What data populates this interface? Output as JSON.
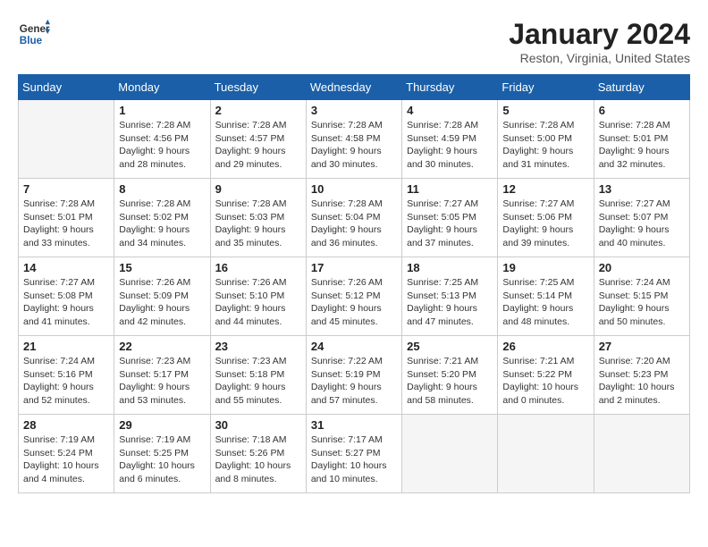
{
  "header": {
    "logo_line1": "General",
    "logo_line2": "Blue",
    "month": "January 2024",
    "location": "Reston, Virginia, United States"
  },
  "days_of_week": [
    "Sunday",
    "Monday",
    "Tuesday",
    "Wednesday",
    "Thursday",
    "Friday",
    "Saturday"
  ],
  "weeks": [
    [
      {
        "day": null,
        "info": null
      },
      {
        "day": "1",
        "info": "Sunrise: 7:28 AM\nSunset: 4:56 PM\nDaylight: 9 hours\nand 28 minutes."
      },
      {
        "day": "2",
        "info": "Sunrise: 7:28 AM\nSunset: 4:57 PM\nDaylight: 9 hours\nand 29 minutes."
      },
      {
        "day": "3",
        "info": "Sunrise: 7:28 AM\nSunset: 4:58 PM\nDaylight: 9 hours\nand 30 minutes."
      },
      {
        "day": "4",
        "info": "Sunrise: 7:28 AM\nSunset: 4:59 PM\nDaylight: 9 hours\nand 30 minutes."
      },
      {
        "day": "5",
        "info": "Sunrise: 7:28 AM\nSunset: 5:00 PM\nDaylight: 9 hours\nand 31 minutes."
      },
      {
        "day": "6",
        "info": "Sunrise: 7:28 AM\nSunset: 5:01 PM\nDaylight: 9 hours\nand 32 minutes."
      }
    ],
    [
      {
        "day": "7",
        "info": "Sunrise: 7:28 AM\nSunset: 5:01 PM\nDaylight: 9 hours\nand 33 minutes."
      },
      {
        "day": "8",
        "info": "Sunrise: 7:28 AM\nSunset: 5:02 PM\nDaylight: 9 hours\nand 34 minutes."
      },
      {
        "day": "9",
        "info": "Sunrise: 7:28 AM\nSunset: 5:03 PM\nDaylight: 9 hours\nand 35 minutes."
      },
      {
        "day": "10",
        "info": "Sunrise: 7:28 AM\nSunset: 5:04 PM\nDaylight: 9 hours\nand 36 minutes."
      },
      {
        "day": "11",
        "info": "Sunrise: 7:27 AM\nSunset: 5:05 PM\nDaylight: 9 hours\nand 37 minutes."
      },
      {
        "day": "12",
        "info": "Sunrise: 7:27 AM\nSunset: 5:06 PM\nDaylight: 9 hours\nand 39 minutes."
      },
      {
        "day": "13",
        "info": "Sunrise: 7:27 AM\nSunset: 5:07 PM\nDaylight: 9 hours\nand 40 minutes."
      }
    ],
    [
      {
        "day": "14",
        "info": "Sunrise: 7:27 AM\nSunset: 5:08 PM\nDaylight: 9 hours\nand 41 minutes."
      },
      {
        "day": "15",
        "info": "Sunrise: 7:26 AM\nSunset: 5:09 PM\nDaylight: 9 hours\nand 42 minutes."
      },
      {
        "day": "16",
        "info": "Sunrise: 7:26 AM\nSunset: 5:10 PM\nDaylight: 9 hours\nand 44 minutes."
      },
      {
        "day": "17",
        "info": "Sunrise: 7:26 AM\nSunset: 5:12 PM\nDaylight: 9 hours\nand 45 minutes."
      },
      {
        "day": "18",
        "info": "Sunrise: 7:25 AM\nSunset: 5:13 PM\nDaylight: 9 hours\nand 47 minutes."
      },
      {
        "day": "19",
        "info": "Sunrise: 7:25 AM\nSunset: 5:14 PM\nDaylight: 9 hours\nand 48 minutes."
      },
      {
        "day": "20",
        "info": "Sunrise: 7:24 AM\nSunset: 5:15 PM\nDaylight: 9 hours\nand 50 minutes."
      }
    ],
    [
      {
        "day": "21",
        "info": "Sunrise: 7:24 AM\nSunset: 5:16 PM\nDaylight: 9 hours\nand 52 minutes."
      },
      {
        "day": "22",
        "info": "Sunrise: 7:23 AM\nSunset: 5:17 PM\nDaylight: 9 hours\nand 53 minutes."
      },
      {
        "day": "23",
        "info": "Sunrise: 7:23 AM\nSunset: 5:18 PM\nDaylight: 9 hours\nand 55 minutes."
      },
      {
        "day": "24",
        "info": "Sunrise: 7:22 AM\nSunset: 5:19 PM\nDaylight: 9 hours\nand 57 minutes."
      },
      {
        "day": "25",
        "info": "Sunrise: 7:21 AM\nSunset: 5:20 PM\nDaylight: 9 hours\nand 58 minutes."
      },
      {
        "day": "26",
        "info": "Sunrise: 7:21 AM\nSunset: 5:22 PM\nDaylight: 10 hours\nand 0 minutes."
      },
      {
        "day": "27",
        "info": "Sunrise: 7:20 AM\nSunset: 5:23 PM\nDaylight: 10 hours\nand 2 minutes."
      }
    ],
    [
      {
        "day": "28",
        "info": "Sunrise: 7:19 AM\nSunset: 5:24 PM\nDaylight: 10 hours\nand 4 minutes."
      },
      {
        "day": "29",
        "info": "Sunrise: 7:19 AM\nSunset: 5:25 PM\nDaylight: 10 hours\nand 6 minutes."
      },
      {
        "day": "30",
        "info": "Sunrise: 7:18 AM\nSunset: 5:26 PM\nDaylight: 10 hours\nand 8 minutes."
      },
      {
        "day": "31",
        "info": "Sunrise: 7:17 AM\nSunset: 5:27 PM\nDaylight: 10 hours\nand 10 minutes."
      },
      {
        "day": null,
        "info": null
      },
      {
        "day": null,
        "info": null
      },
      {
        "day": null,
        "info": null
      }
    ]
  ]
}
